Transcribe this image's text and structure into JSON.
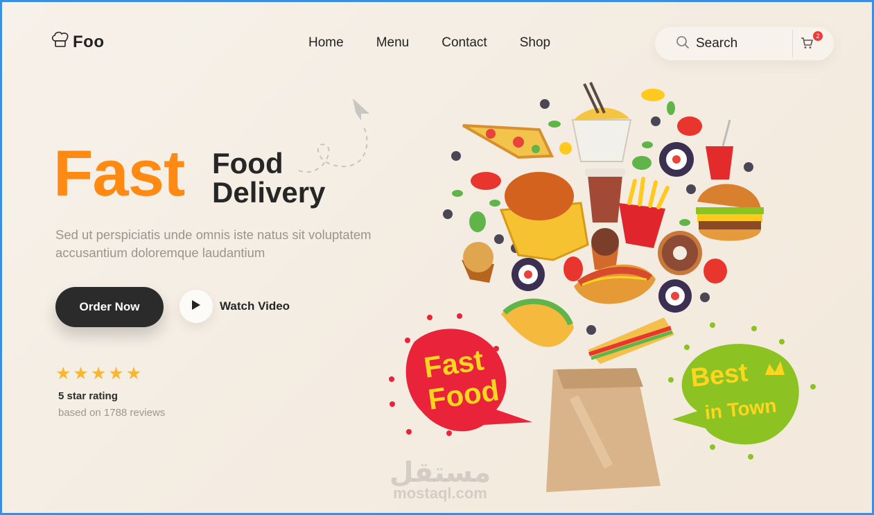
{
  "header": {
    "logo_text": "Foo",
    "nav": [
      {
        "label": "Home"
      },
      {
        "label": "Menu"
      },
      {
        "label": "Contact"
      },
      {
        "label": "Shop"
      }
    ],
    "search_label": "Search",
    "cart_count": "2"
  },
  "hero": {
    "title_highlight": "Fast",
    "title_line1": "Food",
    "title_line2": "Delivery",
    "description": "Sed ut perspiciatis unde omnis iste natus sit voluptatem accusantium doloremque laudantium",
    "order_button": "Order Now",
    "watch_label": "Watch Video"
  },
  "rating": {
    "stars": 5,
    "title": "5 star rating",
    "subtitle": "based on 1788 reviews"
  },
  "badges": {
    "left_line1": "Fast",
    "left_line2": "Food",
    "right_line1": "Best",
    "right_line2": "in Town"
  },
  "watermark": {
    "arabic": "مستقل",
    "latin": "mostaql.com"
  },
  "colors": {
    "accent": "#ff8a13",
    "dark": "#2b2b2b",
    "star": "#f7b733",
    "badge_red": "#e8233a",
    "badge_green": "#8cc323",
    "badge_text": "#ffd61f"
  }
}
